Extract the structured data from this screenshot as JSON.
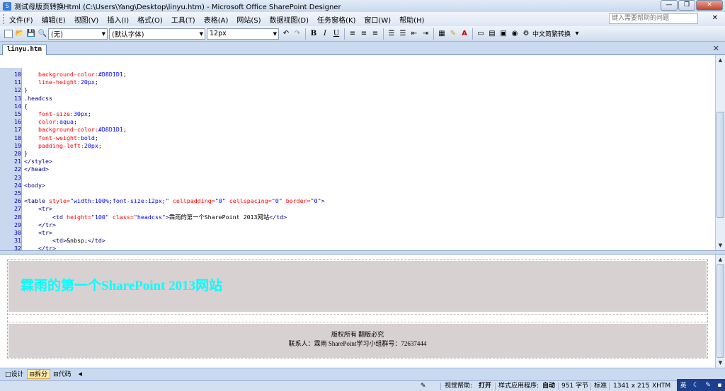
{
  "titlebar": {
    "title": "测试母版页转换Html (C:\\Users\\Yang\\Desktop\\linyu.htm) - Microsoft Office SharePoint Designer"
  },
  "menu": [
    "文件(F)",
    "编辑(E)",
    "视图(V)",
    "插入(I)",
    "格式(O)",
    "工具(T)",
    "表格(A)",
    "网站(S)",
    "数据视图(D)",
    "任务窗格(K)",
    "窗口(W)",
    "帮助(H)"
  ],
  "help_placeholder": "键入需要帮助的问题",
  "toolbar": {
    "style_value": "(无)",
    "font_value": "(默认字体)",
    "size_value": "12px",
    "lang_button": "中文简繁转换"
  },
  "tab": {
    "filename": "linyu.htm"
  },
  "code_lines": [
    {
      "n": "10",
      "segs": [
        {
          "c": "pr",
          "t": "    background-color:"
        },
        {
          "c": "vl",
          "t": "#D8D1D1"
        },
        {
          "c": "tx",
          "t": ";"
        }
      ]
    },
    {
      "n": "11",
      "segs": [
        {
          "c": "pr",
          "t": "    line-height:"
        },
        {
          "c": "vl",
          "t": "20px"
        },
        {
          "c": "tx",
          "t": ";"
        }
      ]
    },
    {
      "n": "12",
      "segs": [
        {
          "c": "tx",
          "t": "}"
        }
      ]
    },
    {
      "n": "13",
      "segs": [
        {
          "c": "tg",
          "t": ".headcss"
        }
      ]
    },
    {
      "n": "14",
      "segs": [
        {
          "c": "tx",
          "t": "{"
        }
      ]
    },
    {
      "n": "15",
      "segs": [
        {
          "c": "pr",
          "t": "    font-size:"
        },
        {
          "c": "vl",
          "t": "30px"
        },
        {
          "c": "tx",
          "t": ";"
        }
      ]
    },
    {
      "n": "16",
      "segs": [
        {
          "c": "pr",
          "t": "    color:"
        },
        {
          "c": "vl",
          "t": "aqua"
        },
        {
          "c": "tx",
          "t": ";"
        }
      ]
    },
    {
      "n": "17",
      "segs": [
        {
          "c": "pr",
          "t": "    background-color:"
        },
        {
          "c": "vl",
          "t": "#D8D1D1"
        },
        {
          "c": "tx",
          "t": ";"
        }
      ]
    },
    {
      "n": "18",
      "segs": [
        {
          "c": "pr",
          "t": "    font-weight:"
        },
        {
          "c": "vl",
          "t": "bold"
        },
        {
          "c": "tx",
          "t": ";"
        }
      ]
    },
    {
      "n": "19",
      "segs": [
        {
          "c": "pr",
          "t": "    padding-left:"
        },
        {
          "c": "vl",
          "t": "20px"
        },
        {
          "c": "tx",
          "t": ";"
        }
      ]
    },
    {
      "n": "20",
      "segs": [
        {
          "c": "tx",
          "t": "}"
        }
      ]
    },
    {
      "n": "21",
      "segs": [
        {
          "c": "tg",
          "t": "</style>"
        }
      ]
    },
    {
      "n": "22",
      "segs": [
        {
          "c": "tg",
          "t": "</head>"
        }
      ]
    },
    {
      "n": "23",
      "segs": []
    },
    {
      "n": "24",
      "segs": [
        {
          "c": "tg",
          "t": "<body>"
        }
      ]
    },
    {
      "n": "25",
      "segs": []
    },
    {
      "n": "26",
      "segs": [
        {
          "c": "tg",
          "t": "<table "
        },
        {
          "c": "at",
          "t": "style="
        },
        {
          "c": "vl",
          "t": "\"width:100%;font-size:12px;\""
        },
        {
          "c": "at",
          "t": " cellpadding="
        },
        {
          "c": "vl",
          "t": "\"0\""
        },
        {
          "c": "at",
          "t": " cellspacing="
        },
        {
          "c": "vl",
          "t": "\"0\""
        },
        {
          "c": "at",
          "t": " border="
        },
        {
          "c": "vl",
          "t": "\"0\""
        },
        {
          "c": "tg",
          "t": ">"
        }
      ]
    },
    {
      "n": "27",
      "segs": [
        {
          "c": "tg",
          "t": "    <tr>"
        }
      ]
    },
    {
      "n": "28",
      "segs": [
        {
          "c": "tg",
          "t": "        <td "
        },
        {
          "c": "at",
          "t": "height="
        },
        {
          "c": "vl",
          "t": "\"100\""
        },
        {
          "c": "at",
          "t": " class="
        },
        {
          "c": "vl",
          "t": "\"headcss\""
        },
        {
          "c": "tg",
          "t": ">"
        },
        {
          "c": "tx",
          "t": "霖雨的第一个SharePoint 2013网站"
        },
        {
          "c": "tg",
          "t": "</td>"
        }
      ]
    },
    {
      "n": "29",
      "segs": [
        {
          "c": "tg",
          "t": "    </tr>"
        }
      ]
    },
    {
      "n": "30",
      "segs": [
        {
          "c": "tg",
          "t": "    <tr>"
        }
      ]
    },
    {
      "n": "31",
      "segs": [
        {
          "c": "tg",
          "t": "        <td>"
        },
        {
          "c": "tx",
          "t": "&nbsp;"
        },
        {
          "c": "tg",
          "t": "</td>"
        }
      ]
    },
    {
      "n": "32",
      "segs": [
        {
          "c": "tg",
          "t": "    </tr>"
        }
      ]
    }
  ],
  "preview": {
    "heading": "霖雨的第一个SharePoint 2013网站",
    "footer_line1": "版权所有 翻版必究",
    "footer_line2": "联系人：霖雨   SharePoint学习小组群号：72637444"
  },
  "view_tabs": [
    "设计",
    "拆分",
    "代码"
  ],
  "status": {
    "vis_aid_label": "视觉帮助:",
    "vis_aid_value": "打开",
    "app_label": "样式应用程序:",
    "app_value": "自动",
    "size": "951 字节",
    "mode": "标准",
    "dims": "1341 x 215",
    "doctype": "XHTM"
  },
  "tray": {
    "lang": "英"
  }
}
